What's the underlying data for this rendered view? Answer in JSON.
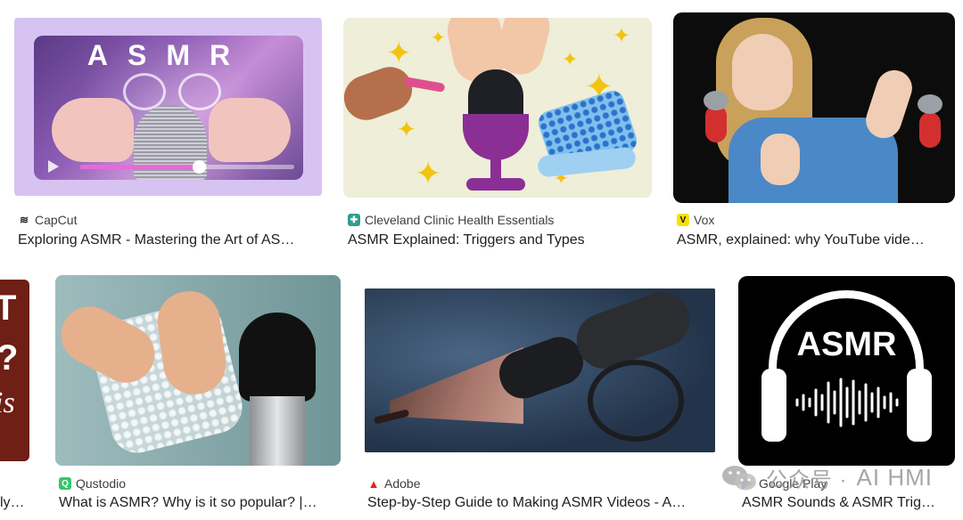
{
  "results": [
    {
      "source": "CapCut",
      "title": "Exploring ASMR - Mastering the Art of AS…",
      "overlay": "ASMR",
      "favicon": "capcut-icon",
      "favicon_color": "#222222"
    },
    {
      "source": "Cleveland Clinic Health Essentials",
      "title": "ASMR Explained: Triggers and Types",
      "favicon": "cleveland-clinic-icon",
      "favicon_color": "#2f9e8f"
    },
    {
      "source": "Vox",
      "title": "ASMR, explained: why YouTube vide…",
      "favicon": "vox-icon",
      "favicon_color": "#f6e100"
    },
    {
      "source": "",
      "title": "ly…",
      "overlay_lines": [
        "T",
        "?",
        "is"
      ]
    },
    {
      "source": "Qustodio",
      "title": "What is ASMR? Why is it so popular? |…",
      "favicon": "qustodio-icon",
      "favicon_color": "#37c46e"
    },
    {
      "source": "Adobe",
      "title": "Step-by-Step Guide to Making ASMR Videos - A…",
      "favicon": "adobe-icon",
      "favicon_color": "#e1251b"
    },
    {
      "source": "Google Play",
      "title": "ASMR Sounds & ASMR Trig…",
      "overlay": "ASMR",
      "favicon": "google-play-icon"
    }
  ],
  "watermark": {
    "text": "公众号 ·",
    "brand": "AI HMI",
    "icon": "wechat-icon"
  }
}
